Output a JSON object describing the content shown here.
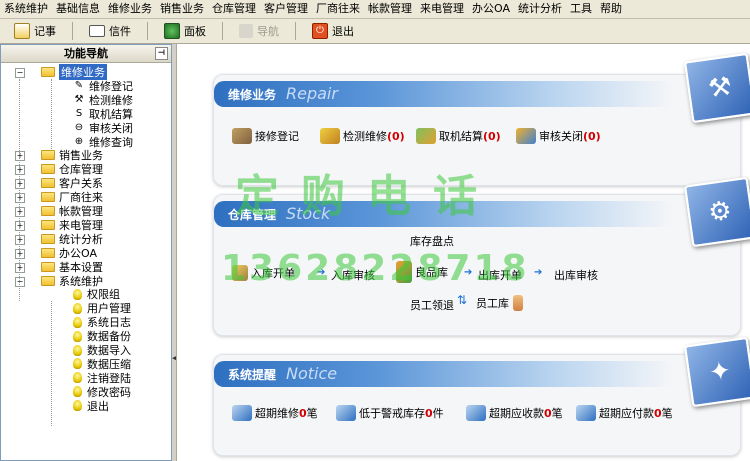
{
  "menu": [
    "系统维护",
    "基础信息",
    "维修业务",
    "销售业务",
    "仓库管理",
    "客户管理",
    "厂商往来",
    "帐款管理",
    "来电管理",
    "办公OA",
    "统计分析",
    "工具",
    "帮助"
  ],
  "toolbar": {
    "notes": "记事",
    "mail": "信件",
    "panel": "面板",
    "nav": "导航",
    "exit": "退出"
  },
  "sidebar": {
    "title": "功能导航",
    "repair_group": "维修业务",
    "repair_items": [
      "维修登记",
      "检测维修",
      "取机结算",
      "审核关闭",
      "维修查询"
    ],
    "groups": [
      "销售业务",
      "仓库管理",
      "客户关系",
      "厂商往来",
      "帐款管理",
      "来电管理",
      "统计分析",
      "办公OA",
      "基本设置",
      "系统维护"
    ],
    "system_items": [
      "权限组",
      "用户管理",
      "系统日志",
      "数据备份",
      "数据导入",
      "数据压缩",
      "注销登陆",
      "修改密码",
      "退出"
    ]
  },
  "repair": {
    "title": "维修业务",
    "en": "Repair",
    "items": [
      {
        "label": "接修登记",
        "count": ""
      },
      {
        "label": "检测维修",
        "count": "(0)"
      },
      {
        "label": "取机结算",
        "count": "(0)"
      },
      {
        "label": "审核关闭",
        "count": "(0)"
      }
    ]
  },
  "stock": {
    "title": "仓库管理",
    "en": "Stock",
    "inventory": "库存盘点",
    "in_open": "入库开单",
    "in_review": "入库审核",
    "good": "良品库",
    "out_open": "出库开单",
    "out_review": "出库审核",
    "staff_receive": "员工领退",
    "staff_store": "员工库"
  },
  "notice": {
    "title": "系统提醒",
    "en": "Notice",
    "items": [
      {
        "pre": "超期维修",
        "num": "0",
        "post": "笔"
      },
      {
        "pre": "低于警戒库存",
        "num": "0",
        "post": "件"
      },
      {
        "pre": "超期应收款",
        "num": "0",
        "post": "笔"
      },
      {
        "pre": "超期应付款",
        "num": "0",
        "post": "笔"
      }
    ]
  },
  "watermark": {
    "text1": "定购电话",
    "text2": "13628228718"
  },
  "colors": {
    "accent": "#2e6fc0",
    "count": "#d00000",
    "selection": "#316ac5"
  }
}
